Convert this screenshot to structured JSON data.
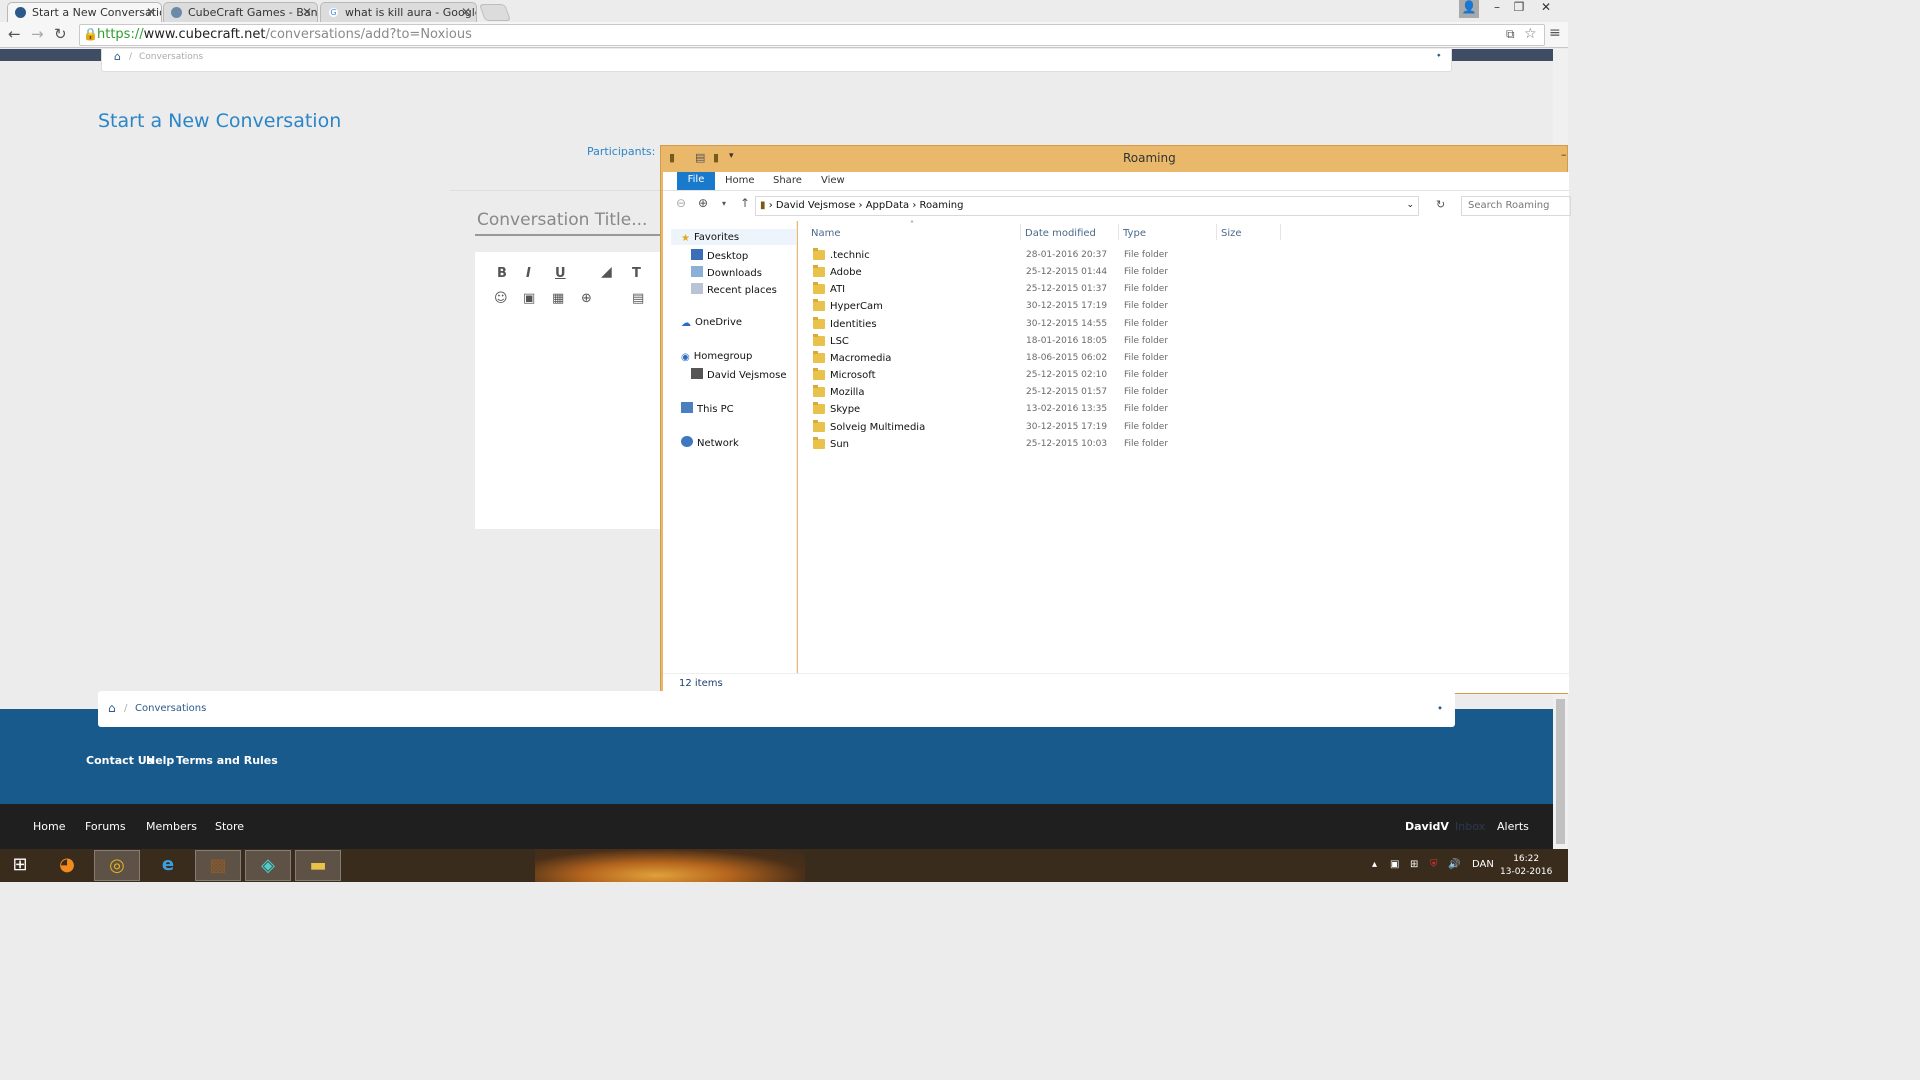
{
  "browser": {
    "tabs": [
      {
        "label": "Start a New Conversation",
        "active": true,
        "favicon": "cubecraft-icon"
      },
      {
        "label": "CubeCraft Games - Ban &",
        "active": false,
        "favicon": "cubecraft-icon"
      },
      {
        "label": "what is kill aura - Google",
        "active": false,
        "favicon": "google-icon"
      }
    ],
    "url": {
      "scheme": "https://",
      "host": "www.cubecraft.net",
      "path": "/conversations/add?to=Noxious"
    }
  },
  "page": {
    "top_breadcrumb": "Conversations",
    "title": "Start a New Conversation",
    "participants_label": "Participants:",
    "conversation_title_placeholder": "Conversation Title...",
    "bottom_breadcrumb": "Conversations",
    "footer_links": [
      "Contact Us",
      "Help",
      "Terms and Rules"
    ],
    "footer_nav": [
      "Home",
      "Forums",
      "Members",
      "Store"
    ],
    "footer_user": "DavidV",
    "footer_inbox": "Inbox",
    "footer_alerts": "Alerts"
  },
  "explorer": {
    "title": "Roaming",
    "ribbon_tabs": [
      "File",
      "Home",
      "Share",
      "View"
    ],
    "address": [
      "David Vejsmose",
      "AppData",
      "Roaming"
    ],
    "search_placeholder": "Search Roaming",
    "nav": {
      "favorites": "Favorites",
      "favorites_items": [
        "Desktop",
        "Downloads",
        "Recent places"
      ],
      "onedrive": "OneDrive",
      "homegroup": "Homegroup",
      "homegroup_user": "David Vejsmose",
      "this_pc": "This PC",
      "network": "Network"
    },
    "columns": [
      "Name",
      "Date modified",
      "Type",
      "Size"
    ],
    "files": [
      {
        "name": ".technic",
        "date": "28-01-2016 20:37",
        "type": "File folder"
      },
      {
        "name": "Adobe",
        "date": "25-12-2015 01:44",
        "type": "File folder"
      },
      {
        "name": "ATI",
        "date": "25-12-2015 01:37",
        "type": "File folder"
      },
      {
        "name": "HyperCam",
        "date": "30-12-2015 17:19",
        "type": "File folder"
      },
      {
        "name": "Identities",
        "date": "30-12-2015 14:55",
        "type": "File folder"
      },
      {
        "name": "LSC",
        "date": "18-01-2016 18:05",
        "type": "File folder"
      },
      {
        "name": "Macromedia",
        "date": "18-06-2015 06:02",
        "type": "File folder"
      },
      {
        "name": "Microsoft",
        "date": "25-12-2015 02:10",
        "type": "File folder"
      },
      {
        "name": "Mozilla",
        "date": "25-12-2015 01:57",
        "type": "File folder"
      },
      {
        "name": "Skype",
        "date": "13-02-2016 13:35",
        "type": "File folder"
      },
      {
        "name": "Solveig Multimedia",
        "date": "30-12-2015 17:19",
        "type": "File folder"
      },
      {
        "name": "Sun",
        "date": "25-12-2015 10:03",
        "type": "File folder"
      }
    ],
    "status": "12 items"
  },
  "taskbar": {
    "language": "DAN",
    "time": "16:22",
    "date": "13-02-2016"
  }
}
